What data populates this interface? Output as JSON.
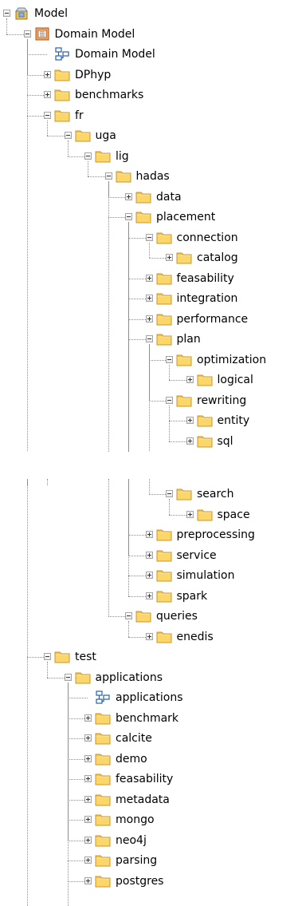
{
  "tree": [
    {
      "label": "Model",
      "icon": "package-model-icon",
      "depth": 0,
      "toggle": "collapse"
    },
    {
      "label": "Domain Model",
      "icon": "view-list-icon",
      "depth": 1,
      "toggle": "collapse"
    },
    {
      "label": "Domain Model",
      "icon": "diagram-icon",
      "depth": 2,
      "toggle": "none"
    },
    {
      "label": "DPhyp",
      "icon": "folder-icon",
      "depth": 2,
      "toggle": "expand"
    },
    {
      "label": "benchmarks",
      "icon": "folder-icon",
      "depth": 2,
      "toggle": "expand"
    },
    {
      "label": "fr",
      "icon": "folder-icon",
      "depth": 2,
      "toggle": "collapse"
    },
    {
      "label": "uga",
      "icon": "folder-icon",
      "depth": 3,
      "toggle": "collapse"
    },
    {
      "label": "lig",
      "icon": "folder-icon",
      "depth": 4,
      "toggle": "collapse"
    },
    {
      "label": "hadas",
      "icon": "folder-icon",
      "depth": 5,
      "toggle": "collapse"
    },
    {
      "label": "data",
      "icon": "folder-icon",
      "depth": 6,
      "toggle": "expand"
    },
    {
      "label": "placement",
      "icon": "folder-icon",
      "depth": 6,
      "toggle": "collapse"
    },
    {
      "label": "connection",
      "icon": "folder-icon",
      "depth": 7,
      "toggle": "collapse"
    },
    {
      "label": "catalog",
      "icon": "folder-icon",
      "depth": 8,
      "toggle": "expand"
    },
    {
      "label": "feasability",
      "icon": "folder-icon",
      "depth": 7,
      "toggle": "expand"
    },
    {
      "label": "integration",
      "icon": "folder-icon",
      "depth": 7,
      "toggle": "expand"
    },
    {
      "label": "performance",
      "icon": "folder-icon",
      "depth": 7,
      "toggle": "expand"
    },
    {
      "label": "plan",
      "icon": "folder-icon",
      "depth": 7,
      "toggle": "collapse"
    },
    {
      "label": "optimization",
      "icon": "folder-icon",
      "depth": 8,
      "toggle": "collapse"
    },
    {
      "label": "logical",
      "icon": "folder-icon",
      "depth": 9,
      "toggle": "expand"
    },
    {
      "label": "rewriting",
      "icon": "folder-icon",
      "depth": 8,
      "toggle": "collapse"
    },
    {
      "label": "entity",
      "icon": "folder-icon",
      "depth": 9,
      "toggle": "expand"
    },
    {
      "label": "sql",
      "icon": "folder-icon",
      "depth": 9,
      "toggle": "expand"
    },
    {
      "label": "search",
      "icon": "folder-icon",
      "depth": 8,
      "toggle": "collapse"
    },
    {
      "label": "space",
      "icon": "folder-icon",
      "depth": 9,
      "toggle": "expand"
    },
    {
      "label": "preprocessing",
      "icon": "folder-icon",
      "depth": 7,
      "toggle": "expand"
    },
    {
      "label": "service",
      "icon": "folder-icon",
      "depth": 7,
      "toggle": "expand"
    },
    {
      "label": "simulation",
      "icon": "folder-icon",
      "depth": 7,
      "toggle": "expand"
    },
    {
      "label": "spark",
      "icon": "folder-icon",
      "depth": 7,
      "toggle": "expand"
    },
    {
      "label": "queries",
      "icon": "folder-icon",
      "depth": 6,
      "toggle": "collapse"
    },
    {
      "label": "enedis",
      "icon": "folder-icon",
      "depth": 7,
      "toggle": "expand"
    },
    {
      "label": "test",
      "icon": "folder-icon",
      "depth": 2,
      "toggle": "collapse"
    },
    {
      "label": "applications",
      "icon": "folder-icon",
      "depth": 3,
      "toggle": "collapse"
    },
    {
      "label": "applications",
      "icon": "diagram-icon",
      "depth": 4,
      "toggle": "none"
    },
    {
      "label": "benchmark",
      "icon": "folder-icon",
      "depth": 4,
      "toggle": "expand"
    },
    {
      "label": "calcite",
      "icon": "folder-icon",
      "depth": 4,
      "toggle": "expand"
    },
    {
      "label": "demo",
      "icon": "folder-icon",
      "depth": 4,
      "toggle": "expand"
    },
    {
      "label": "feasability",
      "icon": "folder-icon",
      "depth": 4,
      "toggle": "expand"
    },
    {
      "label": "metadata",
      "icon": "folder-icon",
      "depth": 4,
      "toggle": "expand"
    },
    {
      "label": "mongo",
      "icon": "folder-icon",
      "depth": 4,
      "toggle": "expand"
    },
    {
      "label": "neo4j",
      "icon": "folder-icon",
      "depth": 4,
      "toggle": "expand"
    },
    {
      "label": "parsing",
      "icon": "folder-icon",
      "depth": 4,
      "toggle": "expand"
    },
    {
      "label": "postgres",
      "icon": "folder-icon",
      "depth": 4,
      "toggle": "expand"
    }
  ]
}
